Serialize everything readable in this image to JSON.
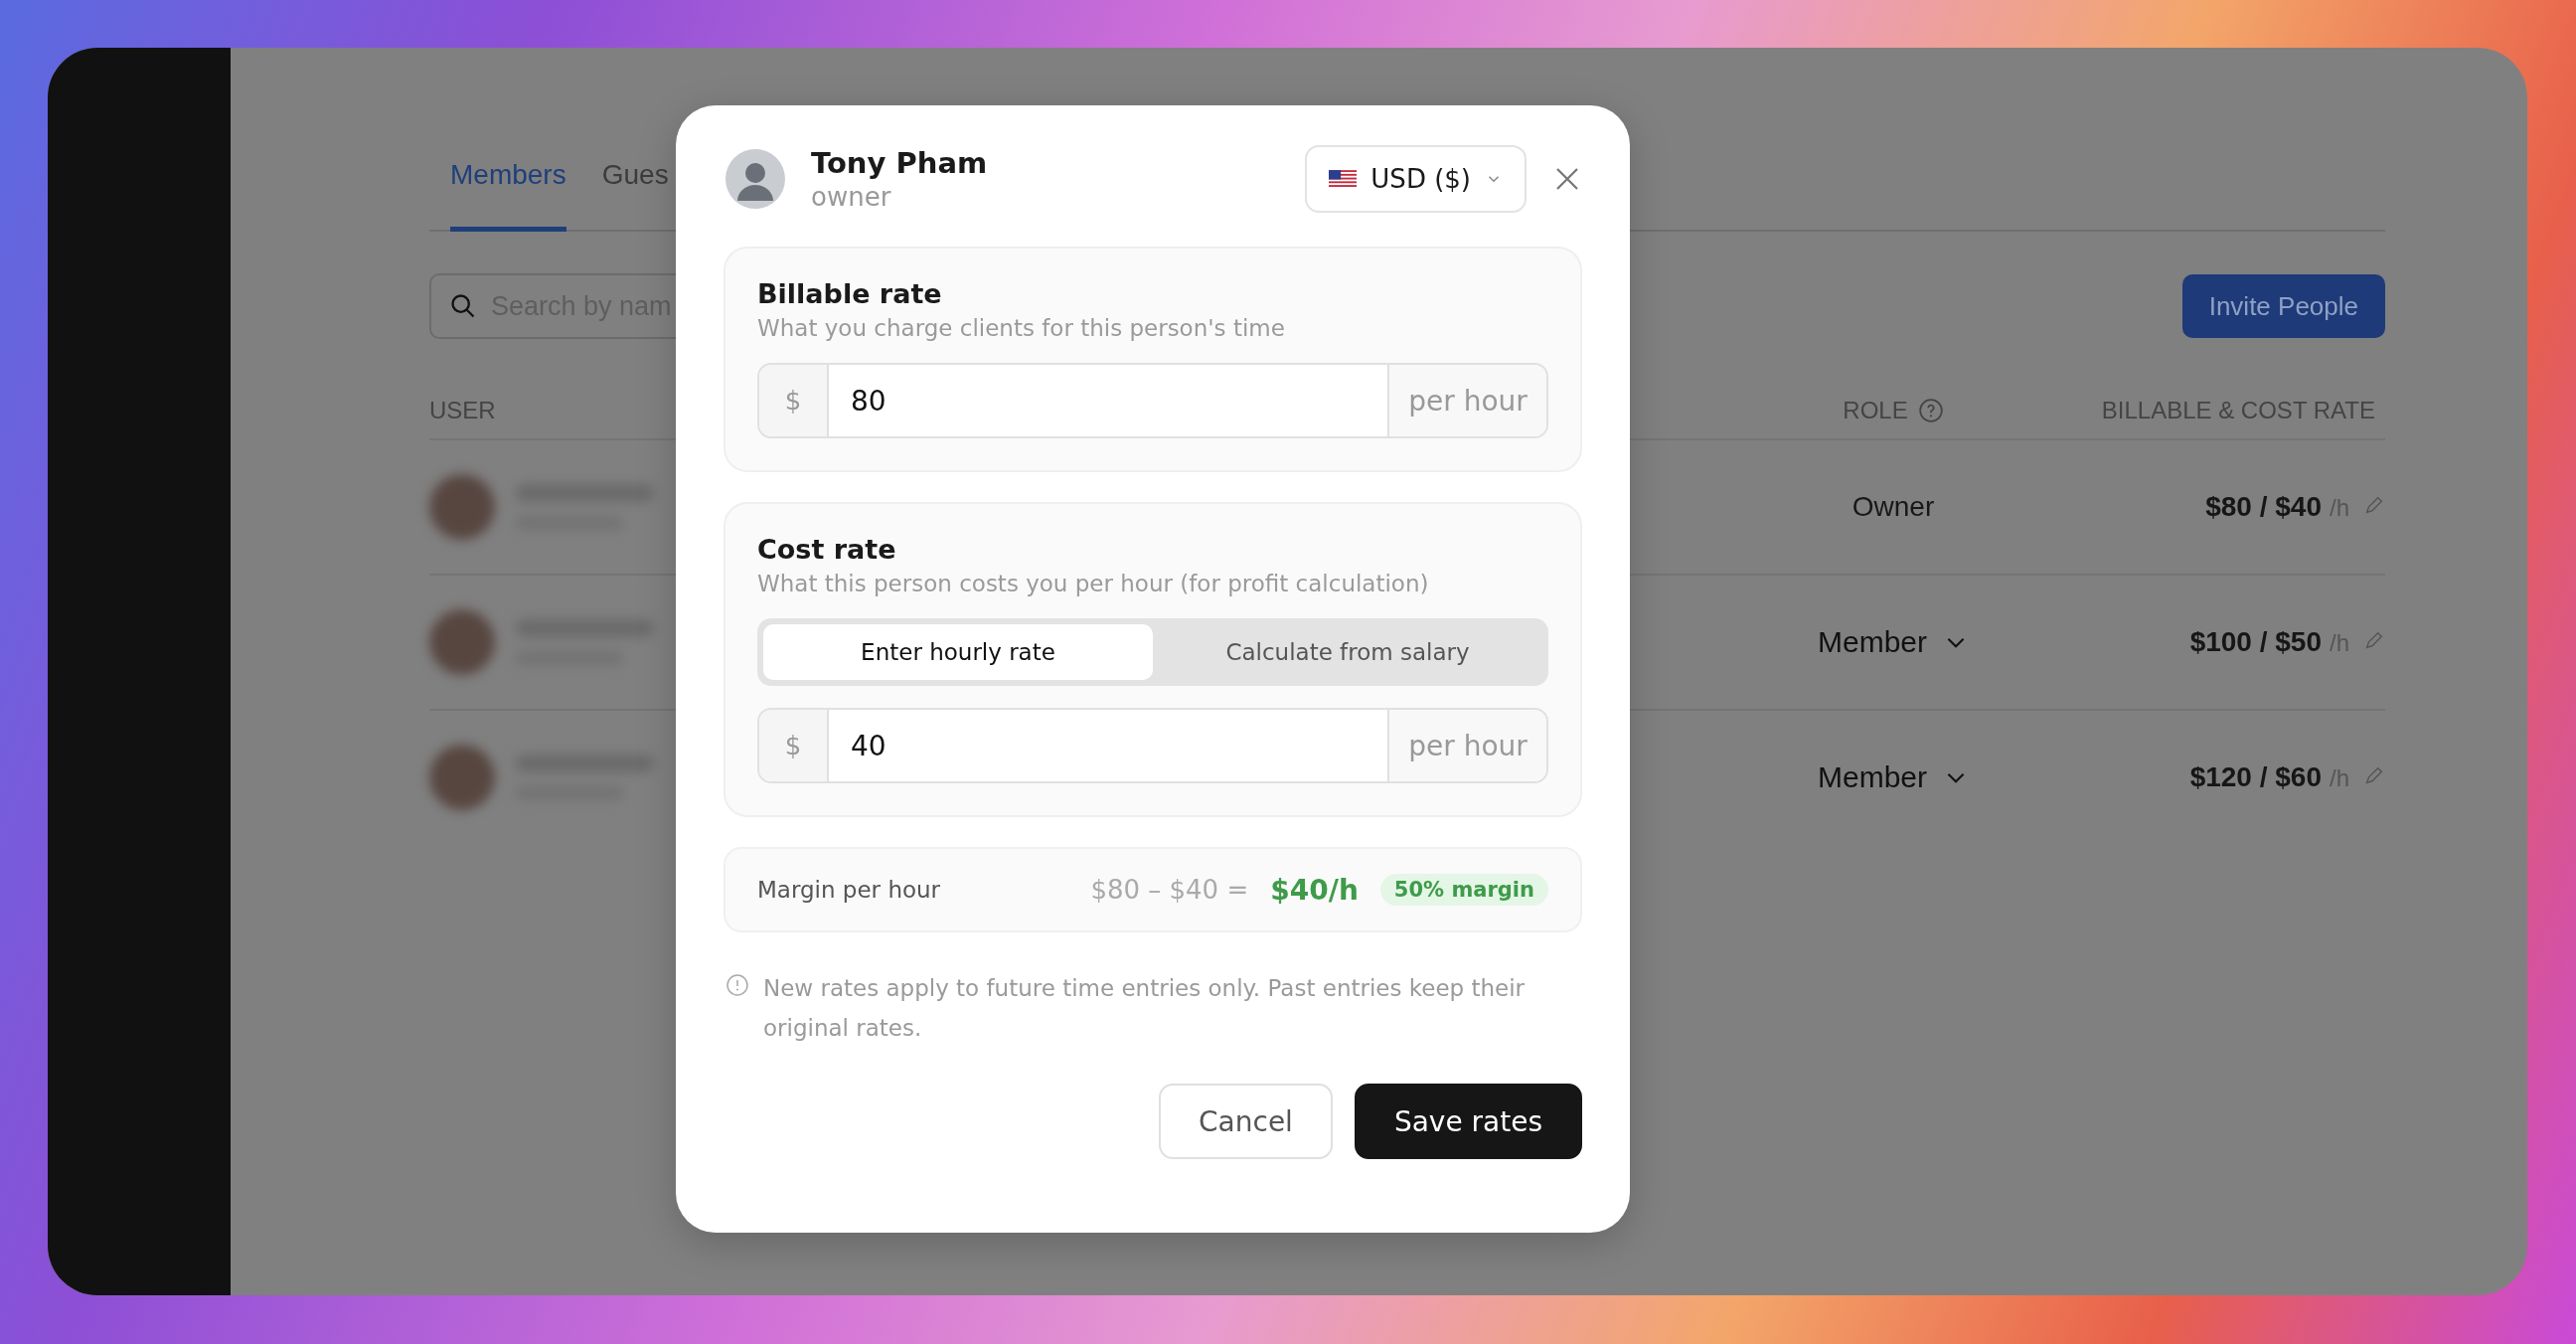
{
  "page": {
    "tabs": [
      {
        "label": "Members",
        "selected": true
      },
      {
        "label": "Gues",
        "selected": false
      }
    ],
    "search": {
      "placeholder": "Search by nam"
    },
    "invite_button": "Invite People",
    "table": {
      "columns": [
        "USER",
        "ROLE",
        "BILLABLE & COST RATE"
      ],
      "rows": [
        {
          "role": "Owner",
          "role_editable": false,
          "rate": "$80 / $40",
          "unit": "/h"
        },
        {
          "role": "Member",
          "role_editable": true,
          "rate": "$100 / $50",
          "unit": "/h"
        },
        {
          "role": "Member",
          "role_editable": true,
          "rate": "$120 / $60",
          "unit": "/h"
        }
      ]
    }
  },
  "dialog": {
    "name": "Tony Pham",
    "role": "owner",
    "currency": "USD ($)",
    "sections": [
      {
        "title": "Billable rate",
        "subtitle": "What you charge clients for this person's time",
        "prefix": "$",
        "value": "80",
        "suffix": "per hour"
      },
      {
        "title": "Cost rate",
        "subtitle": "What this person costs you per hour (for profit calculation)",
        "modes": [
          {
            "label": "Enter hourly rate",
            "selected": true
          },
          {
            "label": "Calculate from salary",
            "selected": false
          }
        ],
        "prefix": "$",
        "value": "40",
        "suffix": "per hour"
      }
    ],
    "margin": {
      "label": "Margin per hour",
      "formula": "$80 – $40 =",
      "result": "$40/h",
      "badge": "50% margin"
    },
    "note": "New rates apply to future time entries only. Past entries keep their original rates.",
    "buttons": [
      {
        "label": "Cancel",
        "kind": "secondary"
      },
      {
        "label": "Save rates",
        "kind": "primary"
      }
    ]
  }
}
